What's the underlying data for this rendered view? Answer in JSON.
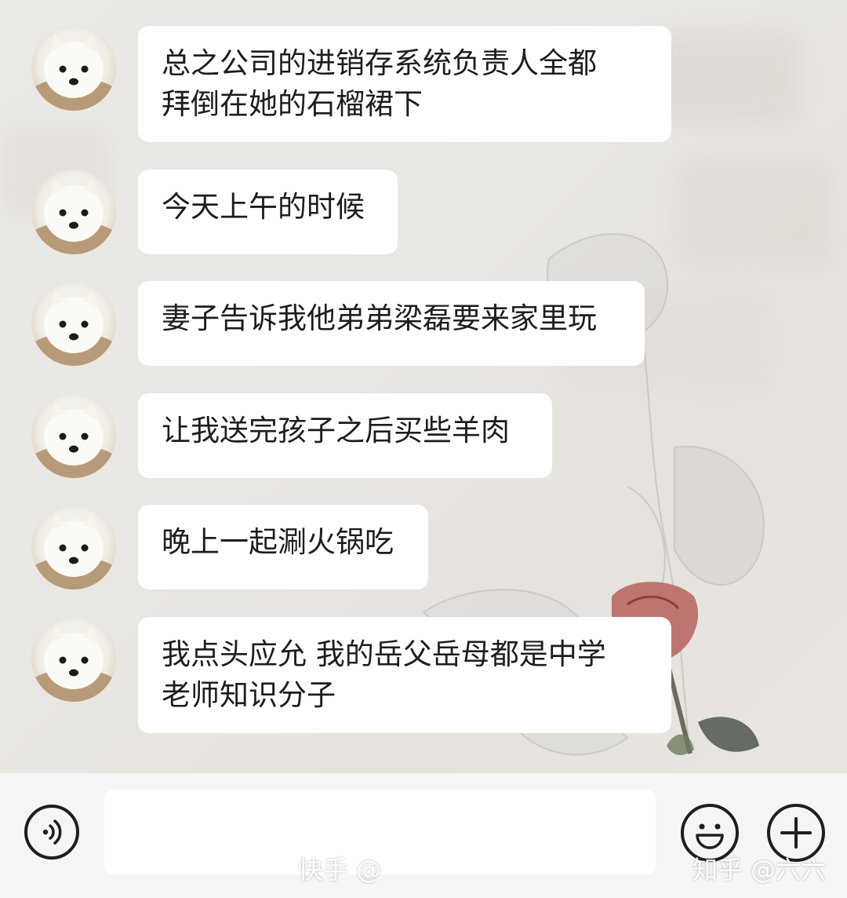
{
  "messages": [
    {
      "text": "总之公司的进销存系统负责人全都\n拜倒在她的石榴裙下"
    },
    {
      "text": "今天上午的时候"
    },
    {
      "text": "妻子告诉我他弟弟梁磊要来家里玩"
    },
    {
      "text": "让我送完孩子之后买些羊肉"
    },
    {
      "text": "晚上一起涮火锅吃"
    },
    {
      "text": "我点头应允 我的岳父岳母都是中学\n老师知识分子"
    }
  ],
  "input_bar": {
    "voice_icon": "voice-icon",
    "emoji_icon": "emoji-icon",
    "plus_icon": "plus-icon"
  },
  "watermarks": {
    "left": "快手 @",
    "right": "知乎 @六六"
  }
}
